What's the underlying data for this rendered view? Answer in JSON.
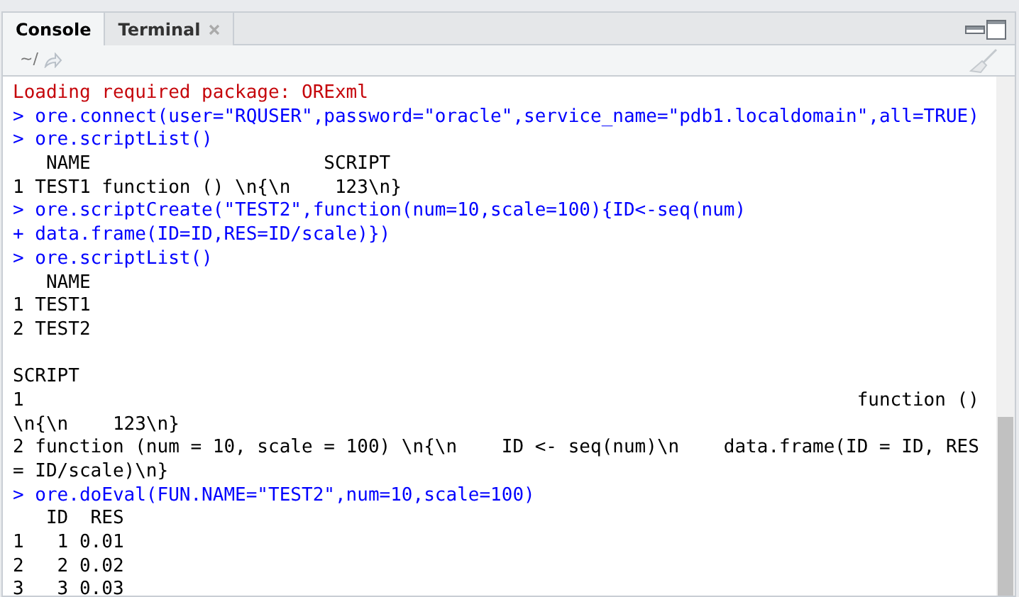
{
  "tabs": [
    {
      "label": "Console",
      "selected": true,
      "closable": false
    },
    {
      "label": "Terminal",
      "selected": false,
      "closable": true
    }
  ],
  "toolbar": {
    "path": "~/"
  },
  "console": {
    "lines": [
      {
        "kind": "message",
        "text": "Loading required package: ORExml"
      },
      {
        "kind": "input",
        "text": "> ore.connect(user=\"RQUSER\",password=\"oracle\",service_name=\"pdb1.localdomain\",all=TRUE)"
      },
      {
        "kind": "input",
        "text": "> ore.scriptList()"
      },
      {
        "kind": "output",
        "text": "   NAME                     SCRIPT"
      },
      {
        "kind": "output",
        "text": "1 TEST1 function () \\n{\\n    123\\n}"
      },
      {
        "kind": "input",
        "text": "> ore.scriptCreate(\"TEST2\",function(num=10,scale=100){ID<-seq(num)"
      },
      {
        "kind": "input",
        "text": "+ data.frame(ID=ID,RES=ID/scale)})"
      },
      {
        "kind": "input",
        "text": "> ore.scriptList()"
      },
      {
        "kind": "output",
        "text": "   NAME"
      },
      {
        "kind": "output",
        "text": "1 TEST1"
      },
      {
        "kind": "output",
        "text": "2 TEST2"
      },
      {
        "kind": "blank"
      },
      {
        "kind": "output",
        "text": "SCRIPT"
      },
      {
        "kind": "output",
        "text": "1                                                                           function ()"
      },
      {
        "kind": "output",
        "text": "\\n{\\n    123\\n}"
      },
      {
        "kind": "output",
        "text": "2 function (num = 10, scale = 100) \\n{\\n    ID <- seq(num)\\n    data.frame(ID = ID, RES"
      },
      {
        "kind": "output",
        "text": "= ID/scale)\\n}"
      },
      {
        "kind": "input",
        "text": "> ore.doEval(FUN.NAME=\"TEST2\",num=10,scale=100)"
      },
      {
        "kind": "output",
        "text": "   ID  RES"
      },
      {
        "kind": "output",
        "text": "1   1 0.01"
      },
      {
        "kind": "output",
        "text": "2   2 0.02"
      },
      {
        "kind": "output",
        "text": "3   3 0.03"
      }
    ]
  }
}
